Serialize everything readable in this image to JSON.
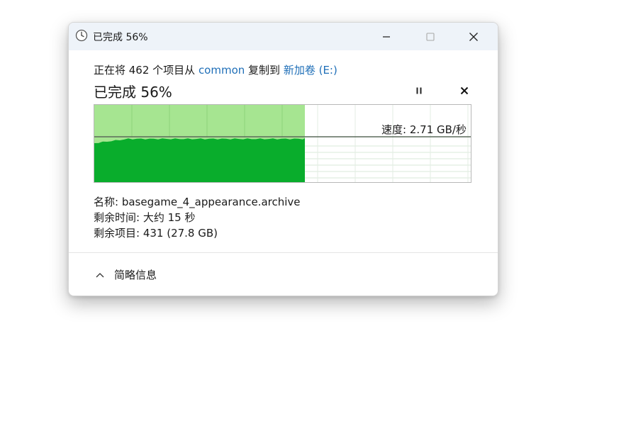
{
  "window": {
    "title": "已完成 56%",
    "icon": "clock-icon",
    "controls": {
      "minimize": "minimize-icon",
      "maximize": "maximize-icon",
      "close": "close-icon"
    }
  },
  "copy": {
    "prefix": "正在将 462 个项目从 ",
    "source": "common",
    "middle": " 复制到 ",
    "destination": "新加卷 (E:)",
    "status": "已完成 56%",
    "progress_fraction": 0.56,
    "pause_icon": "pause-icon",
    "cancel_icon": "cancel-icon"
  },
  "graph": {
    "speed_label": "速度: 2.71 GB/秒"
  },
  "details": {
    "name": "名称: basegame_4_appearance.archive",
    "time_left": "剩余时间: 大约 15 秒",
    "items_left": "剩余项目: 431 (27.8 GB)"
  },
  "footer": {
    "label": "简略信息",
    "icon": "chevron-up-icon"
  },
  "colors": {
    "accent": "#1f6fb8",
    "graph_fill": "#09ad2c",
    "graph_progress_bg": "#a6e591",
    "titlebar": "#eef3f9"
  }
}
